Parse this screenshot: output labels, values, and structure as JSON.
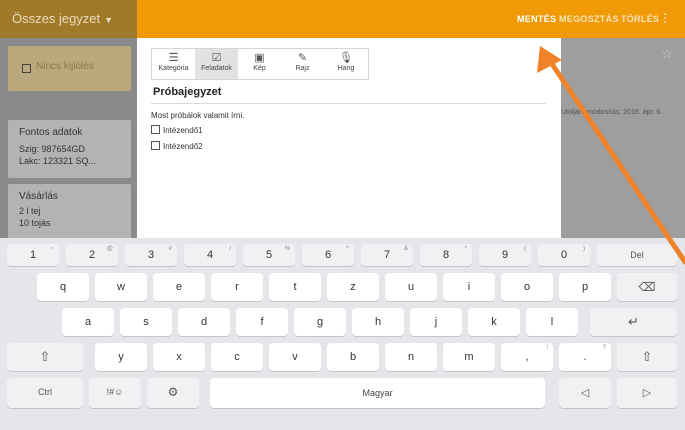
{
  "topbar": {
    "list_title": "Összes jegyzet",
    "save": "MENTÉS",
    "share": "MEGOSZTÁS",
    "delete": "TÖRLÉS",
    "more": "⋮"
  },
  "notes": {
    "card1_title": "Nincs kijlölés",
    "card2": {
      "title": "Fontos adatok",
      "line1": "Szig: 987654GD",
      "line2": "Lakc: 123321 SQ..."
    },
    "card3": {
      "title": "Vásárlás",
      "line1": "2 l tej",
      "line2": "10 tojás"
    }
  },
  "side_info": {
    "modified": "Utoljára módosítás: 2018. ápr. 6."
  },
  "editor": {
    "tools": [
      {
        "icon": "list-icon",
        "glyph": "☰",
        "label": "Kategória"
      },
      {
        "icon": "checkbox-icon",
        "glyph": "☑",
        "label": "Feladatok"
      },
      {
        "icon": "image-icon",
        "glyph": "▣",
        "label": "Kép"
      },
      {
        "icon": "pen-icon",
        "glyph": "✎",
        "label": "Rajz"
      },
      {
        "icon": "mic-icon",
        "glyph": "🎙",
        "label": "Hang"
      }
    ],
    "title": "Próbajegyzet",
    "body": "Most próbálok valamit írni.",
    "todos": [
      "Intézendő1",
      "Intézendő2"
    ]
  },
  "keyboard": {
    "row1": [
      {
        "k": "1",
        "s": "~"
      },
      {
        "k": "2",
        "s": "@"
      },
      {
        "k": "3",
        "s": "#"
      },
      {
        "k": "4",
        "s": "/"
      },
      {
        "k": "5",
        "s": "%"
      },
      {
        "k": "6",
        "s": "^"
      },
      {
        "k": "7",
        "s": "&"
      },
      {
        "k": "8",
        "s": "*"
      },
      {
        "k": "9",
        "s": "("
      },
      {
        "k": "0",
        "s": ")"
      }
    ],
    "del": "Del",
    "row2": [
      "q",
      "w",
      "e",
      "r",
      "t",
      "z",
      "u",
      "i",
      "o",
      "p"
    ],
    "backspace": "⌫",
    "row3": [
      "a",
      "s",
      "d",
      "f",
      "g",
      "h",
      "j",
      "k",
      "l"
    ],
    "enter": "↵",
    "shift": "⇧",
    "row4": [
      "y",
      "x",
      "c",
      "v",
      "b",
      "n",
      "m"
    ],
    "comma": {
      "k": ",",
      "s": "!"
    },
    "period": {
      "k": ".",
      "s": "?"
    },
    "ctrl": "Ctrl",
    "symbols": "!#☺",
    "settings": "⚙",
    "space": "Magyar",
    "left": "◁",
    "right": "▷"
  },
  "colors": {
    "accent": "#ef9a06",
    "arrow": "#f0832a"
  }
}
